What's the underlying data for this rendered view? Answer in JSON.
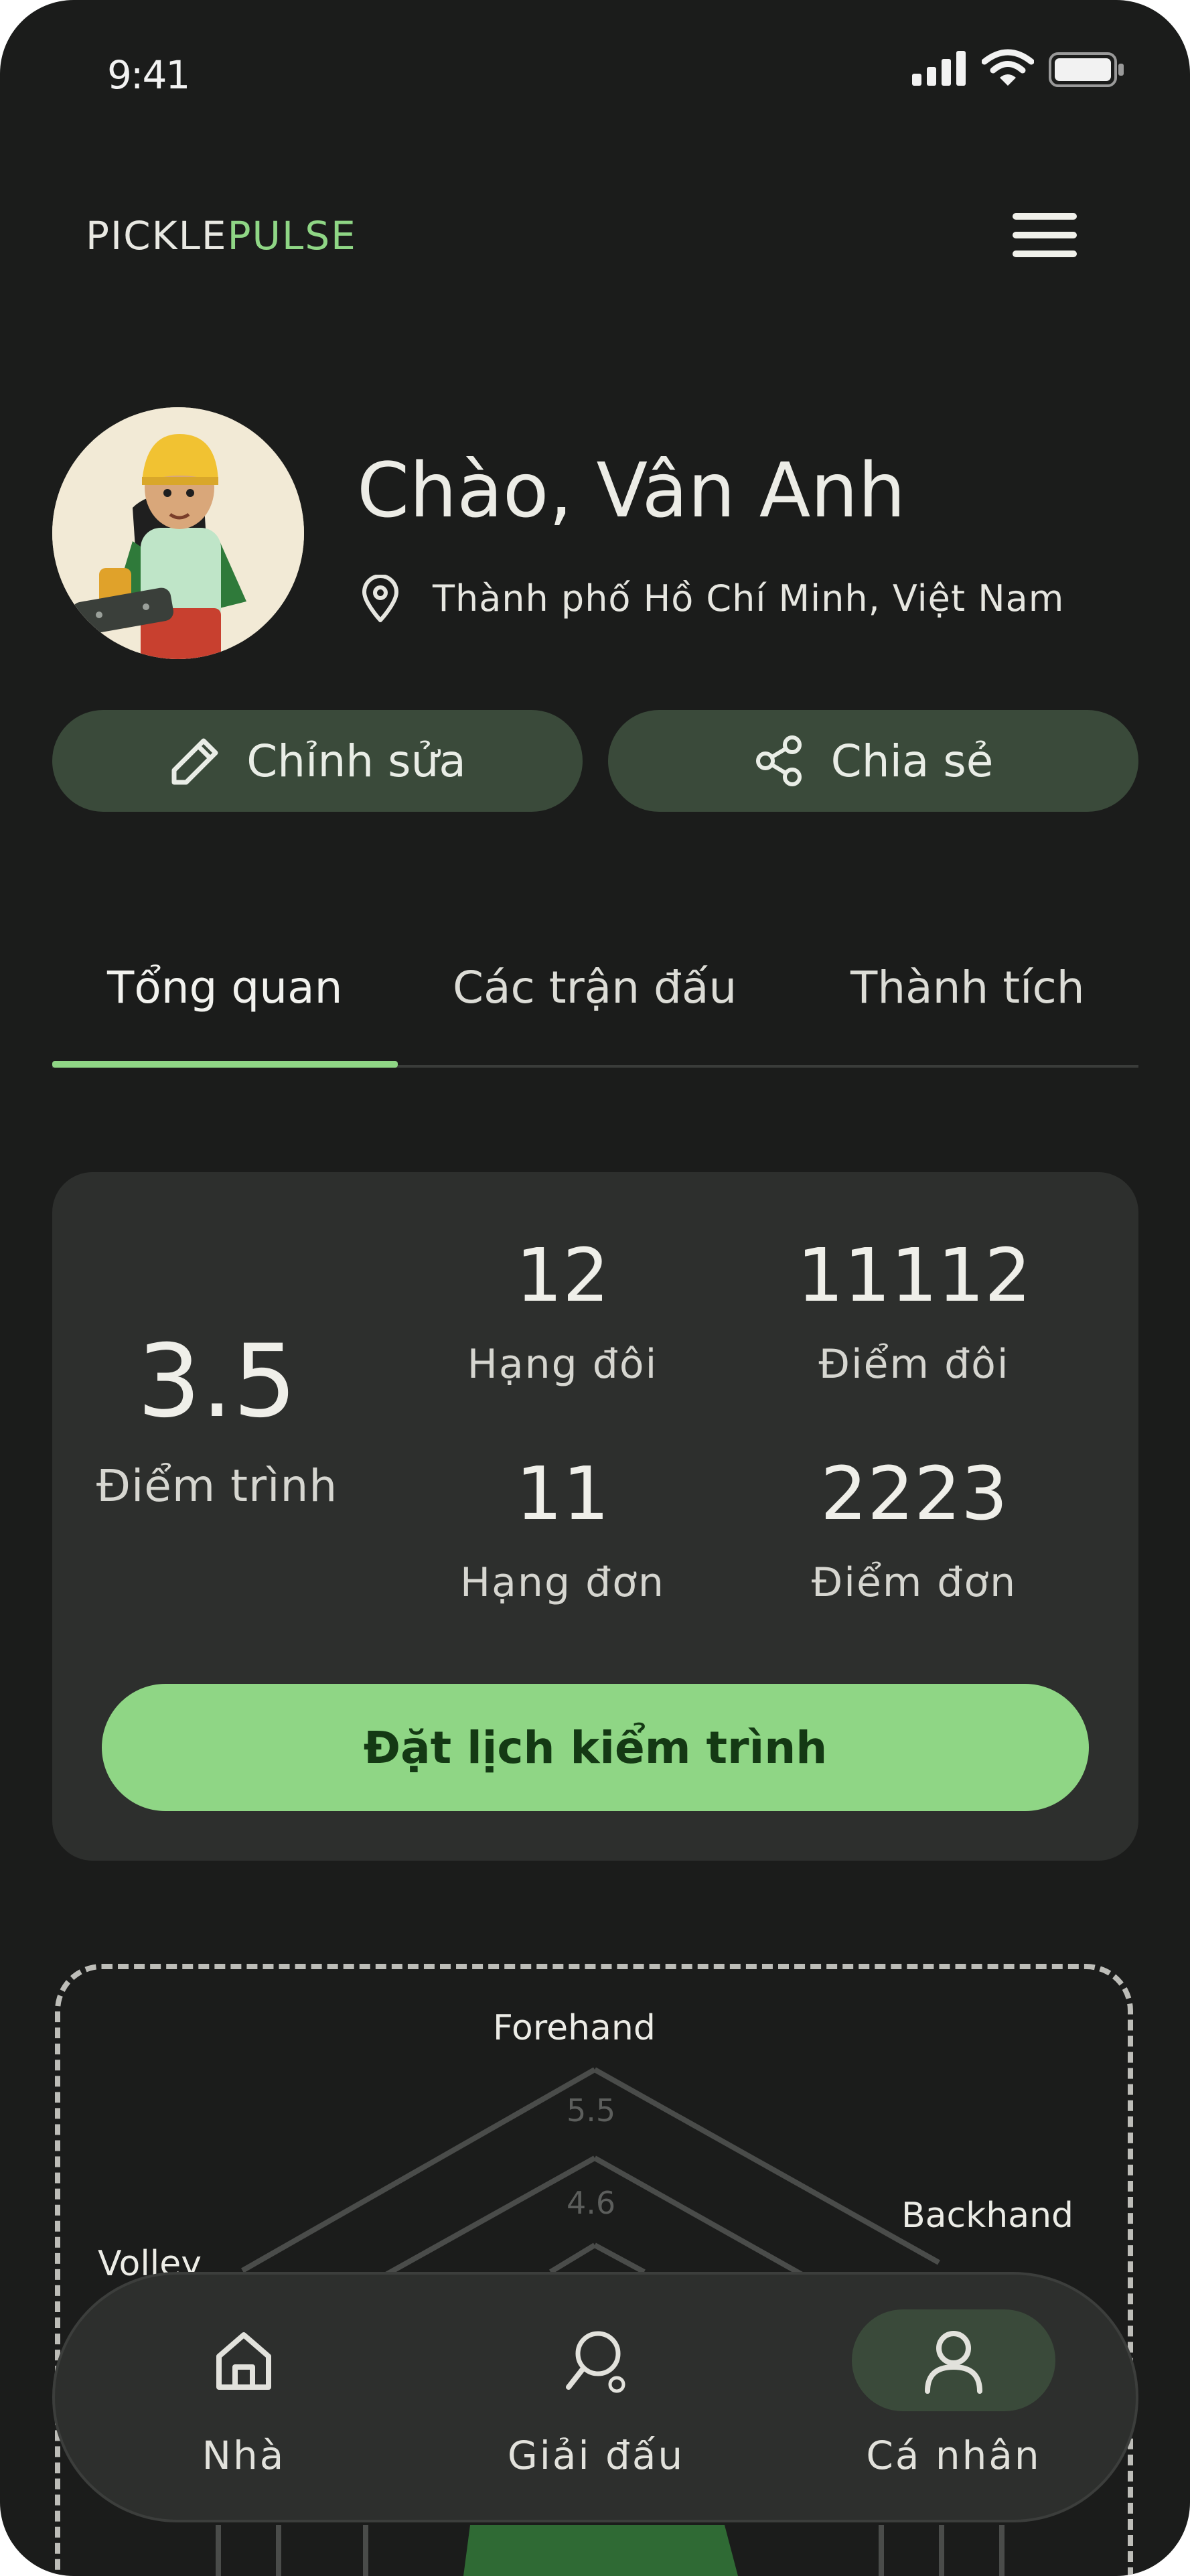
{
  "status_bar": {
    "time": "9:41"
  },
  "header": {
    "brand_prefix": "PICKLE",
    "brand_suffix": "PULSE"
  },
  "profile": {
    "greeting": "Chào, Vân Anh",
    "location": "Thành phố Hồ Chí Minh, Việt Nam",
    "edit_label": "Chỉnh sửa",
    "share_label": "Chia sẻ"
  },
  "tabs": [
    {
      "label": "Tổng quan"
    },
    {
      "label": "Các trận đấu"
    },
    {
      "label": "Thành tích"
    }
  ],
  "overview": {
    "skill_value": "3.5",
    "skill_label": "Điểm trình",
    "doubles_rank_value": "12",
    "doubles_rank_label": "Hạng đôi",
    "doubles_points_value": "11112",
    "doubles_points_label": "Điểm đôi",
    "singles_rank_value": "11",
    "singles_rank_label": "Hạng đơn",
    "singles_points_value": "2223",
    "singles_points_label": "Điểm đơn",
    "cta_label": "Đặt lịch kiểm trình"
  },
  "radar": {
    "axes": [
      "Forehand",
      "Backhand",
      "Volley"
    ],
    "levels": [
      "5.5",
      "4.6"
    ]
  },
  "bottom_nav": [
    {
      "label": "Nhà",
      "icon": "home-icon"
    },
    {
      "label": "Giải đấu",
      "icon": "paddle-icon"
    },
    {
      "label": "Cá nhân",
      "icon": "user-icon"
    }
  ],
  "colors": {
    "background": "#1b1c1b",
    "card": "#2d2f2d",
    "accent": "#8fd685",
    "pill": "#3a4a3a"
  }
}
